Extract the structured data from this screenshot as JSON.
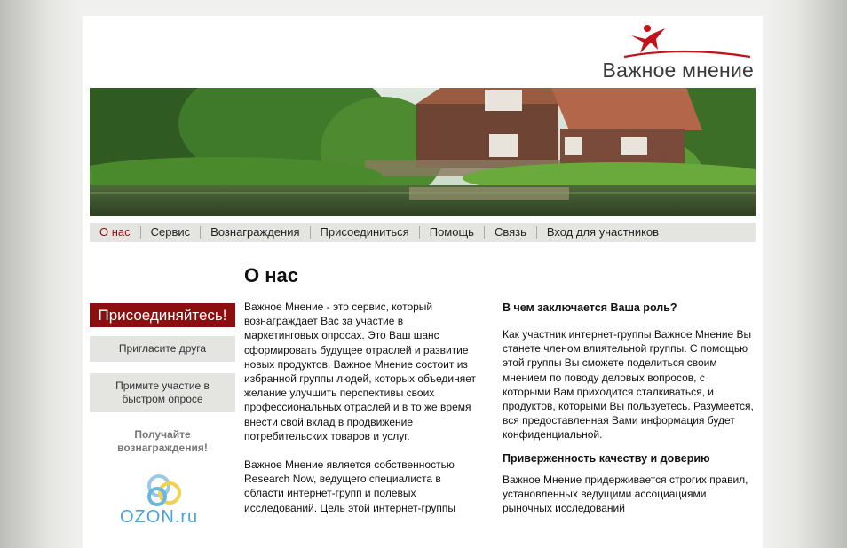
{
  "logo": {
    "text": "Важное мнение"
  },
  "nav": {
    "items": [
      {
        "label": "О нас",
        "active": true
      },
      {
        "label": "Сервис"
      },
      {
        "label": "Вознаграждения"
      },
      {
        "label": "Присоединиться"
      },
      {
        "label": "Помощь"
      },
      {
        "label": "Связь"
      },
      {
        "label": "Вход для участников"
      }
    ]
  },
  "sidebar": {
    "join_header": "Присоединяйтесь!",
    "invite_friend": "Пригласите друга",
    "quick_survey": "Примите участие в быстром опросе",
    "rewards_line1": "Получайте",
    "rewards_line2": "вознаграждения!",
    "partner_logo_text": "OZON.ru"
  },
  "main": {
    "title": "О нас",
    "left_paragraph_1": "Важное Мнение - это сервис, который вознаграждает Вас за участие в маркетинговых опросах. Это Ваш шанс сформировать будущее  отраслей и развитие новых продуктов. Важное Мнение состоит из избранной группы людей, которых объединяет желание улучшить перспективы своих профессиональных отраслей и в то же время внести свой вклад в продвижение потребительских товаров и услуг.",
    "left_paragraph_2": "Важное Мнение является собственностью Research Now, ведущего специалиста в области интернет-групп и полевых исследований. Цель этой интернет-группы",
    "right_heading_1": "В чем заключается Ваша роль?",
    "right_paragraph_1": "Как участник интернет-группы Важное Мнение Вы станете членом влиятельной группы. С помощью этой группы Вы сможете поделиться своим мнением по поводу деловых вопросов, с которыми Вам приходится сталкиваться, и продуктов, которыми Вы пользуетесь. Разумеется, вся предоставленная Вами информация будет конфиденциальной.",
    "right_heading_2": "Приверженность качеству и доверию",
    "right_paragraph_2": "Важное Мнение придерживается строгих правил, установленных ведущими ассоциациями рыночных исследований"
  },
  "colors": {
    "accent": "#8c0e0e",
    "nav_bg": "#e4e5e1",
    "link_active": "#8c1010"
  }
}
